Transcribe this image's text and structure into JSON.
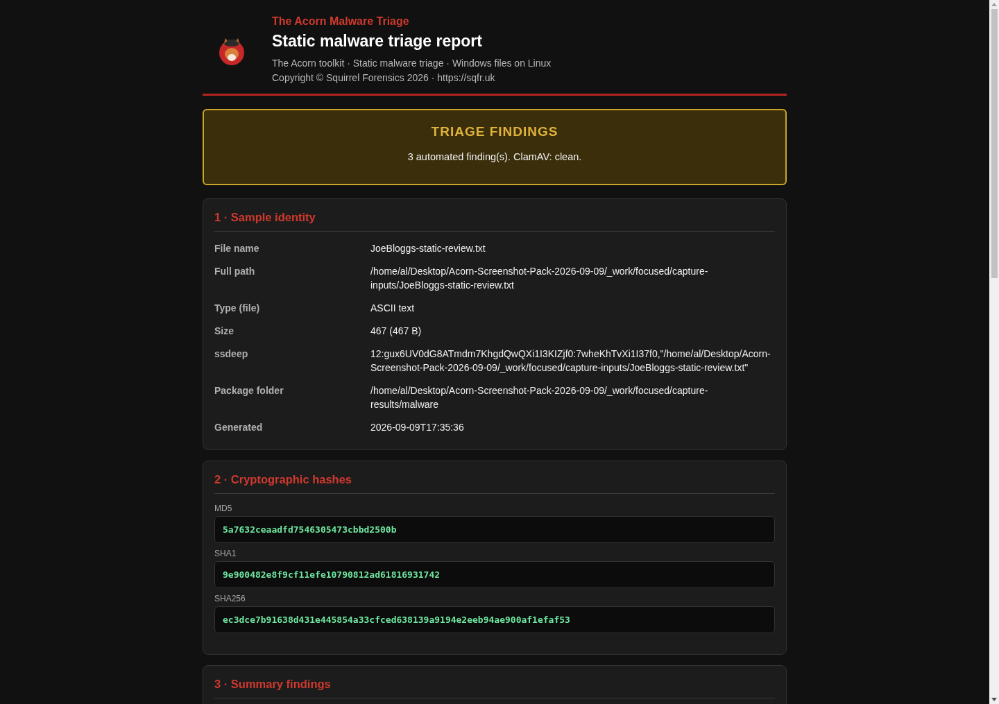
{
  "header": {
    "brand": "The Acorn Malware Triage",
    "title": "Static malware triage report",
    "subtitle": "The Acorn toolkit · Static malware triage · Windows files on Linux",
    "copyright": "Copyright © Squirrel Forensics 2026 · https://sqfr.uk"
  },
  "findings": {
    "title": "TRIAGE FINDINGS",
    "summary": "3 automated finding(s). ClamAV: clean."
  },
  "sections": [
    {
      "kind": "fields",
      "title": "1 · Sample identity",
      "rows": [
        {
          "label": "File name",
          "value": "JoeBloggs-static-review.txt"
        },
        {
          "label": "Full path",
          "value": "/home/al/Desktop/Acorn-Screenshot-Pack-2026-09-09/_work/focused/capture-inputs/JoeBloggs-static-review.txt"
        },
        {
          "label": "Type (file)",
          "value": "ASCII text"
        },
        {
          "label": "Size",
          "value": "467 (467 B)"
        },
        {
          "label": "ssdeep",
          "value": "12:gux6UV0dG8ATmdm7KhgdQwQXi1I3KIZjf0:7wheKhTvXi1I37f0,\"/home/al/Desktop/Acorn-Screenshot-Pack-2026-09-09/_work/focused/capture-inputs/JoeBloggs-static-review.txt\""
        },
        {
          "label": "Package folder",
          "value": "/home/al/Desktop/Acorn-Screenshot-Pack-2026-09-09/_work/focused/capture-results/malware"
        },
        {
          "label": "Generated",
          "value": "2026-09-09T17:35:36"
        }
      ]
    },
    {
      "kind": "hashes",
      "title": "2 · Cryptographic hashes",
      "hashes": [
        {
          "label": "MD5",
          "value": "5a7632ceaadfd7546305473cbbd2500b"
        },
        {
          "label": "SHA1",
          "value": "9e900482e8f9cf11efe10790812ad61816931742"
        },
        {
          "label": "SHA256",
          "value": "ec3dce7b91638d431e445854a33cfced638139a9194e2eeb94ae900af1efaf53"
        }
      ]
    },
    {
      "kind": "fields",
      "title": "3 · Summary findings"
    }
  ]
}
